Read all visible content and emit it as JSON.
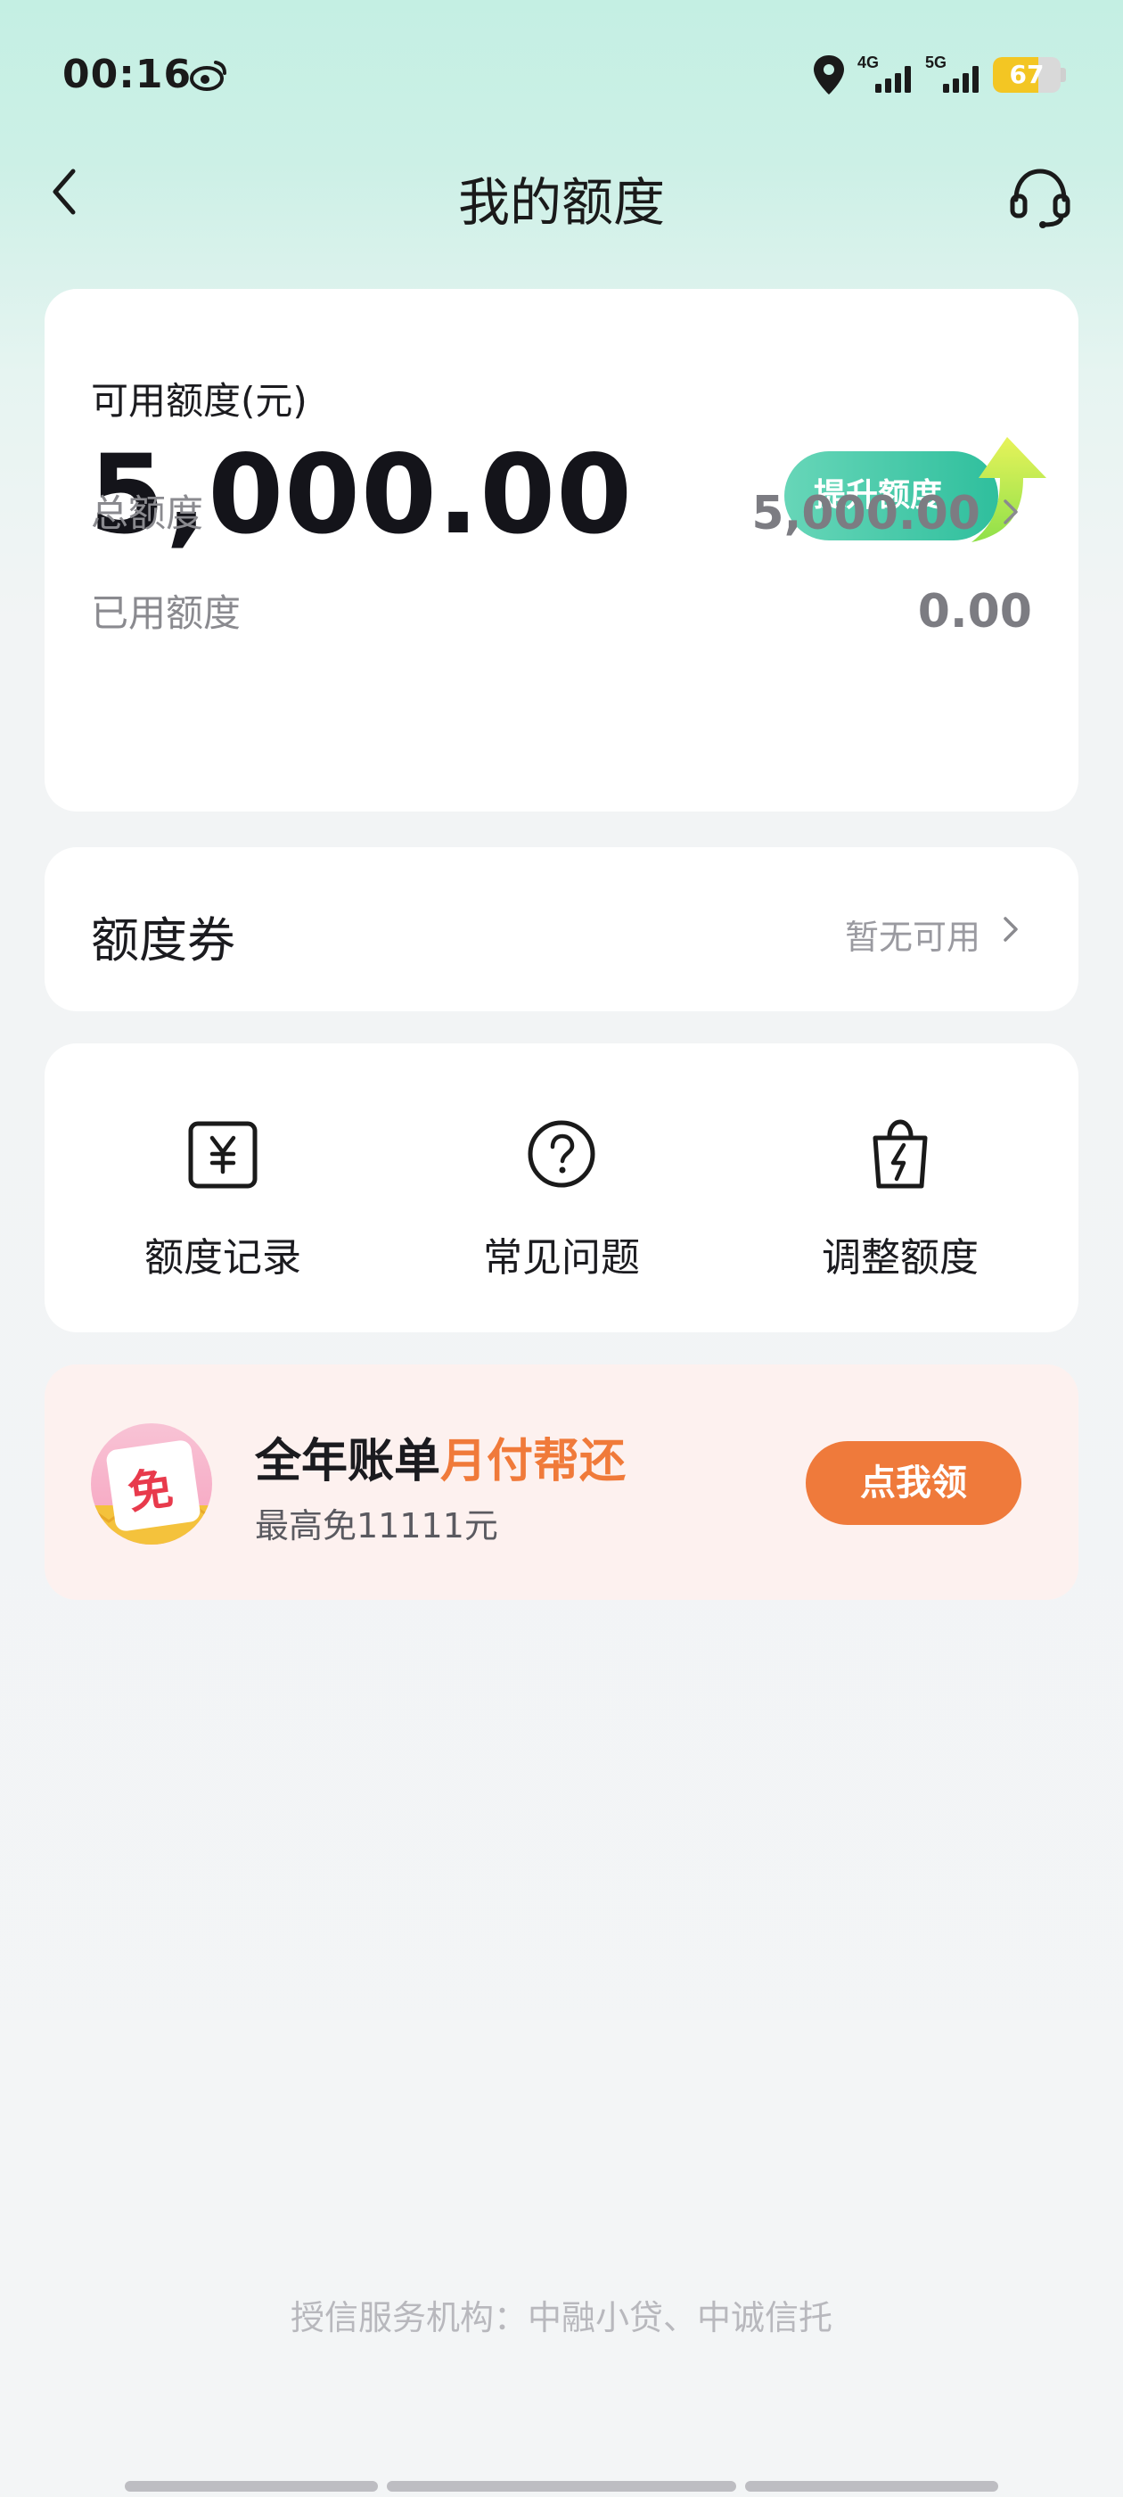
{
  "status_bar": {
    "time": "00:16",
    "signal_1": "4G",
    "signal_2": "5G",
    "battery_percent": "67",
    "battery_level": 0.67
  },
  "nav": {
    "title": "我的额度",
    "back_icon": "chevron-left-icon",
    "support_icon": "headset-icon"
  },
  "limit_card": {
    "available_label": "可用额度(元)",
    "available_amount": "5,000.00",
    "raise_button": "提升额度",
    "total_label": "总额度",
    "total_value": "5,000.00",
    "used_label": "已用额度",
    "used_value": "0.00"
  },
  "coupon_card": {
    "title": "额度券",
    "status": "暂无可用"
  },
  "actions": [
    {
      "label": "额度记录",
      "icon": "yuan-record-icon"
    },
    {
      "label": "常见问题",
      "icon": "question-circle-icon"
    },
    {
      "label": "调整额度",
      "icon": "lightning-bag-icon"
    }
  ],
  "promo": {
    "badge_char": "免",
    "title_main": "全年账单",
    "title_highlight": "月付帮还",
    "subtitle": "最高免11111元",
    "button": "点我领"
  },
  "footer": {
    "text": "授信服务机构：中融小贷、中诚信托"
  },
  "colors": {
    "accent_green": "#2fbf9d",
    "promo_orange": "#ef7a3b",
    "battery_yellow": "#f3c623"
  }
}
